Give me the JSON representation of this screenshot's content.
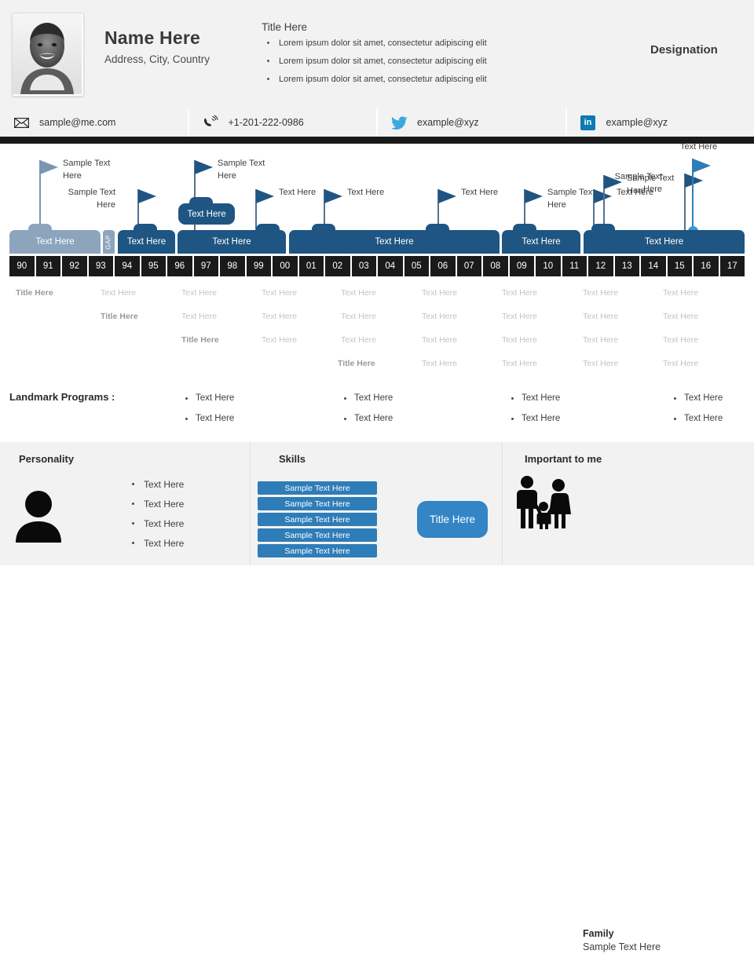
{
  "header": {
    "name": "Name Here",
    "address": "Address, City, Country",
    "bullets_title": "Title Here",
    "bullets": [
      "Lorem ipsum dolor sit amet, consectetur adipiscing elit",
      "Lorem ipsum dolor sit amet, consectetur adipiscing elit",
      "Lorem ipsum dolor sit amet, consectetur adipiscing elit"
    ],
    "designation": "Designation",
    "photo_icon": "portrait-photo"
  },
  "contacts": [
    {
      "icon": "envelope-icon",
      "value": "sample@me.com"
    },
    {
      "icon": "phone-icon",
      "value": "+1-201-222-0986"
    },
    {
      "icon": "twitter-icon",
      "value": "example@xyz"
    },
    {
      "icon": "linkedin-icon",
      "value": "example@xyz",
      "badge": "in"
    }
  ],
  "timeline": {
    "years": [
      "90",
      "91",
      "92",
      "93",
      "94",
      "95",
      "96",
      "97",
      "98",
      "99",
      "00",
      "01",
      "02",
      "03",
      "04",
      "05",
      "06",
      "07",
      "08",
      "09",
      "10",
      "11",
      "12",
      "13",
      "14",
      "15",
      "16",
      "17"
    ],
    "gap_label": "GAP",
    "bars": [
      {
        "label": "Text Here",
        "start": 0,
        "span": 4,
        "color": "#8da4bd",
        "kind": "main"
      },
      {
        "label": "Text Here",
        "start": 4,
        "span": 2,
        "color": "#1f5582",
        "kind": "main"
      },
      {
        "label": "Text Here",
        "start": 6,
        "span": 4,
        "color": "#1f5582",
        "kind": "main"
      },
      {
        "label": "Text Here",
        "start": 10,
        "span": 8,
        "color": "#1f5582",
        "kind": "main"
      },
      {
        "label": "Text Here",
        "start": 19,
        "span": 3,
        "color": "#1f5582",
        "kind": "main"
      },
      {
        "label": "Text Here",
        "start": 22,
        "span": 6,
        "color": "#1f5582",
        "kind": "main"
      }
    ],
    "sub_bar": {
      "label": "Text Here"
    },
    "flags": [
      {
        "label": "Sample Text\nHere",
        "color": "#7b95b2",
        "side": "right"
      },
      {
        "label": "Sample Text\nHere",
        "color": "#1f5582",
        "side": "left"
      },
      {
        "label": "Sample Text\nHere",
        "color": "#1f5582",
        "side": "right"
      },
      {
        "label": "Text Here",
        "color": "#1f5582",
        "side": "right"
      },
      {
        "label": "Text Here",
        "color": "#1f5582",
        "side": "right"
      },
      {
        "label": "Text Here",
        "color": "#1f5582",
        "side": "right"
      },
      {
        "label": "Sample Text\nHere",
        "color": "#1f5582",
        "side": "right"
      },
      {
        "label": "Text Here",
        "color": "#1f5582",
        "side": "right"
      },
      {
        "label": "Sample Text\nHere",
        "color": "#1f5582",
        "side": "right"
      },
      {
        "label": "Sample Text\nHere",
        "color": "#1f5582",
        "side": "right"
      },
      {
        "label": "Text Here",
        "color": "#2e7db8",
        "side": "right",
        "marker": "circle"
      }
    ]
  },
  "grid": {
    "title_text": "Title Here",
    "cell_text": "Text Here",
    "rows": [
      [
        "Title Here",
        "Text Here",
        "Text Here",
        "Text Here",
        "Text Here",
        "Text Here",
        "Text Here",
        "Text Here",
        "Text Here"
      ],
      [
        "",
        "Title Here",
        "Text Here",
        "Text Here",
        "Text Here",
        "Text Here",
        "Text Here",
        "Text Here",
        "Text Here"
      ],
      [
        "",
        "",
        "Title Here",
        "Text Here",
        "Text Here",
        "Text Here",
        "Text Here",
        "Text Here",
        "Text Here"
      ],
      [
        "",
        "",
        "",
        "Title Here",
        "Text Here",
        "Text Here",
        "Text Here",
        "Text Here",
        "Text Here"
      ]
    ]
  },
  "landmark": {
    "label": "Landmark Programs :",
    "columns": [
      [
        "Text Here",
        "Text Here"
      ],
      [
        "Text Here",
        "Text Here"
      ],
      [
        "Text Here",
        "Text Here"
      ],
      [
        "Text Here",
        "Text Here"
      ]
    ]
  },
  "bottom": {
    "personality": {
      "heading": "Personality",
      "icon": "person-icon",
      "items": [
        "Text Here",
        "Text Here",
        "Text Here",
        "Text Here"
      ]
    },
    "skills": {
      "heading": "Skills",
      "items": [
        "Sample Text Here",
        "Sample Text Here",
        "Sample Text Here",
        "Sample Text Here",
        "Sample Text Here"
      ]
    },
    "title_pill": "Title Here",
    "important": {
      "heading": "Important to me",
      "icon": "family-icon",
      "name": "Family",
      "detail": "Sample Text Here"
    }
  },
  "colors": {
    "dark_navy": "#1f5582",
    "light_steel": "#8da4bd",
    "bright_blue": "#2e7db8",
    "band_black": "#1a1a1a",
    "panel_grey": "#f2f2f2"
  }
}
